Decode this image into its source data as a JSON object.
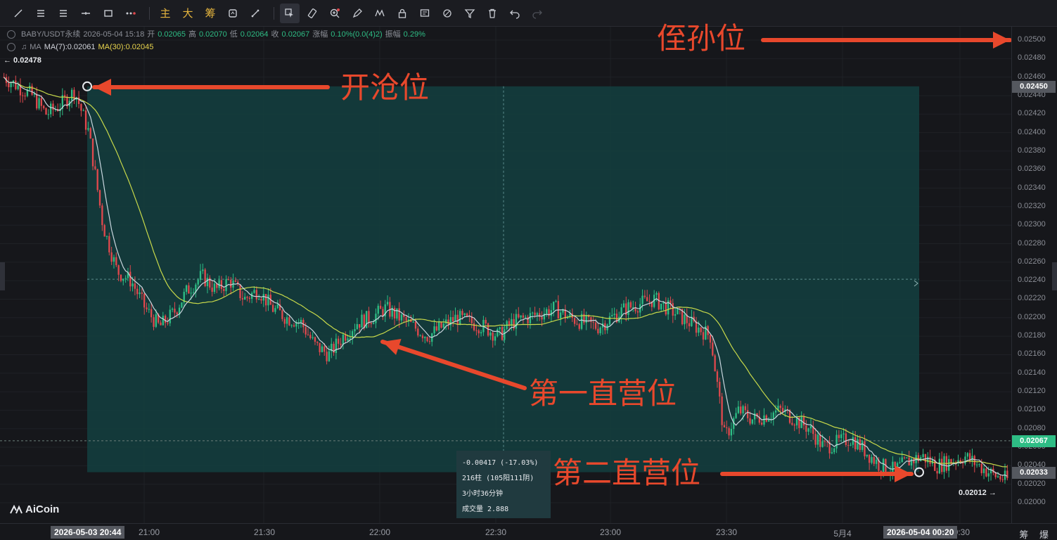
{
  "toolbar": {
    "tools": [
      "trend-line-icon",
      "horizontal-lines-icon",
      "parallel-lines-icon",
      "ray-icon",
      "rectangle-icon",
      "more-shapes-icon"
    ],
    "text_buttons": [
      "主",
      "大",
      "筹"
    ],
    "tools2": [
      "magnet-icon",
      "measure-icon",
      "cursor-select-icon",
      "ruler-icon",
      "zoom-in-icon",
      "pen-icon",
      "pattern-icon",
      "lock-icon",
      "text-note-icon",
      "link-icon",
      "filter-icon",
      "trash-icon",
      "undo-icon",
      "redo-icon"
    ]
  },
  "legend": {
    "symbol": "BABY/USDT永续",
    "datetime": "2026-05-04 15:18",
    "open_label": "开",
    "open": "0.02065",
    "high_label": "高",
    "high": "0.02070",
    "low_label": "低",
    "low": "0.02064",
    "close_label": "收",
    "close": "0.02067",
    "change_label": "涨幅",
    "change": "0.10%(0.0(4)2)",
    "amp_label": "振幅",
    "amp": "0.29%",
    "ma_label": "MA",
    "ma7": "MA(7):0.02061",
    "ma30": "MA(30):0.02045"
  },
  "y_ticks": [
    "0.02500",
    "0.02480",
    "0.02460",
    "0.02440",
    "0.02420",
    "0.02400",
    "0.02380",
    "0.02360",
    "0.02340",
    "0.02320",
    "0.02300",
    "0.02280",
    "0.02260",
    "0.02240",
    "0.02220",
    "0.02200",
    "0.02180",
    "0.02160",
    "0.02140",
    "0.02120",
    "0.02100",
    "0.02080",
    "0.02060",
    "0.02040",
    "0.02020",
    "0.02000"
  ],
  "y_tags": {
    "top_rect": "0.02450",
    "current": "0.02067",
    "bottom_rect": "0.02033"
  },
  "x_ticks": [
    "21:00",
    "21:30",
    "22:00",
    "22:30",
    "23:00",
    "23:30",
    "5月4",
    "00:30"
  ],
  "x_tags": {
    "start": "2026-05-03 20:44",
    "end": "2026-05-04 00:20"
  },
  "axis_buttons": "筹 爆",
  "high_label": "← 0.02478",
  "low_label": "0.02012 →",
  "annotations": {
    "take_profit": "侄孙位",
    "entry": "开沧位",
    "first_target": "第一直营位",
    "second_target": "第二直营位"
  },
  "measure_info": {
    "change": "-0.00417 (-17.03%)",
    "bars": "216柱 (105阳111阴)",
    "duration": "3小时36分钟",
    "volume": "成交量 2.888"
  },
  "logo": "AiCoin",
  "colors": {
    "up": "#2ebd85",
    "down": "#e0484d",
    "ma7": "#c9d6de",
    "ma30": "#c8d94a",
    "rect_fill": "#133f3f",
    "annotation": "#e8482c"
  },
  "chart_data": {
    "type": "candlestick",
    "ylim": [
      0.0199,
      0.0251
    ],
    "close_path": [
      0.0246,
      0.0245,
      0.0244,
      0.0242,
      0.0243,
      0.02445,
      0.024,
      0.023,
      0.0225,
      0.0224,
      0.0221,
      0.0219,
      0.02205,
      0.0223,
      0.02245,
      0.0223,
      0.0224,
      0.0222,
      0.0223,
      0.0221,
      0.022,
      0.02195,
      0.0217,
      0.0216,
      0.0218,
      0.02195,
      0.022,
      0.0221,
      0.022,
      0.0219,
      0.0218,
      0.0219,
      0.022,
      0.02195,
      0.0219,
      0.0218,
      0.02195,
      0.022,
      0.02205,
      0.0221,
      0.022,
      0.02195,
      0.0219,
      0.022,
      0.0221,
      0.02215,
      0.0222,
      0.0221,
      0.022,
      0.0219,
      0.0218,
      0.0207,
      0.021,
      0.0209,
      0.02095,
      0.021,
      0.0209,
      0.0208,
      0.0206,
      0.02065,
      0.0207,
      0.02055,
      0.0204,
      0.02035,
      0.02045,
      0.0205,
      0.0204,
      0.02045,
      0.0205,
      0.0204,
      0.0203,
      0.02025
    ]
  }
}
